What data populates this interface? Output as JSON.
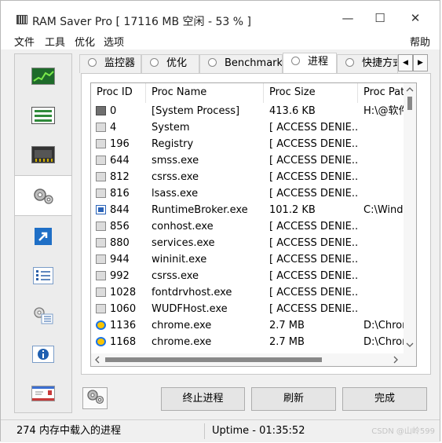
{
  "window": {
    "title": "RAM Saver Pro [ 17116 MB 空闲 - 53 % ]",
    "minimize_glyph": "—",
    "maximize_glyph": "☐",
    "close_glyph": "✕"
  },
  "menu": {
    "file": "文件",
    "tools": "工具",
    "optimize": "优化",
    "options": "选项",
    "help": "帮助"
  },
  "sidebar": {
    "items": [
      {
        "icon": "monitor-chart-icon"
      },
      {
        "icon": "list-icon"
      },
      {
        "icon": "memory-chip-icon"
      },
      {
        "icon": "gears-icon"
      },
      {
        "icon": "shortcut-arrow-icon"
      },
      {
        "icon": "checklist-icon"
      },
      {
        "icon": "settings-list-icon"
      },
      {
        "icon": "info-icon"
      },
      {
        "icon": "mail-icon"
      }
    ],
    "active_index": 3
  },
  "tabs": [
    {
      "label": "监控器"
    },
    {
      "label": "优化"
    },
    {
      "label": "Benchmark"
    },
    {
      "label": "进程"
    },
    {
      "label": "快捷方式"
    }
  ],
  "process_table": {
    "columns": [
      "Proc ID",
      "Proc Name",
      "Proc Size",
      "Proc Pat"
    ],
    "rows": [
      {
        "icon": "system-process-icon",
        "id": "0",
        "name": "[System Process]",
        "size": "413.6 KB",
        "path": "H:\\@软件"
      },
      {
        "icon": "generic-process-icon",
        "id": "4",
        "name": "System",
        "size": "[ ACCESS DENIE...",
        "path": ""
      },
      {
        "icon": "generic-process-icon",
        "id": "196",
        "name": "Registry",
        "size": "[ ACCESS DENIE...",
        "path": ""
      },
      {
        "icon": "generic-process-icon",
        "id": "644",
        "name": "smss.exe",
        "size": "[ ACCESS DENIE...",
        "path": ""
      },
      {
        "icon": "generic-process-icon",
        "id": "812",
        "name": "csrss.exe",
        "size": "[ ACCESS DENIE...",
        "path": ""
      },
      {
        "icon": "generic-process-icon",
        "id": "816",
        "name": "lsass.exe",
        "size": "[ ACCESS DENIE...",
        "path": ""
      },
      {
        "icon": "app-window-icon",
        "id": "844",
        "name": "RuntimeBroker.exe",
        "size": "101.2 KB",
        "path": "C:\\Windo"
      },
      {
        "icon": "generic-process-icon",
        "id": "856",
        "name": "conhost.exe",
        "size": "[ ACCESS DENIE...",
        "path": ""
      },
      {
        "icon": "generic-process-icon",
        "id": "880",
        "name": "services.exe",
        "size": "[ ACCESS DENIE...",
        "path": ""
      },
      {
        "icon": "generic-process-icon",
        "id": "944",
        "name": "wininit.exe",
        "size": "[ ACCESS DENIE...",
        "path": ""
      },
      {
        "icon": "generic-process-icon",
        "id": "992",
        "name": "csrss.exe",
        "size": "[ ACCESS DENIE...",
        "path": ""
      },
      {
        "icon": "generic-process-icon",
        "id": "1028",
        "name": "fontdrvhost.exe",
        "size": "[ ACCESS DENIE...",
        "path": ""
      },
      {
        "icon": "generic-process-icon",
        "id": "1060",
        "name": "WUDFHost.exe",
        "size": "[ ACCESS DENIE...",
        "path": ""
      },
      {
        "icon": "chrome-icon",
        "id": "1136",
        "name": "chrome.exe",
        "size": "2.7 MB",
        "path": "D:\\Chron"
      },
      {
        "icon": "chrome-icon",
        "id": "1168",
        "name": "chrome.exe",
        "size": "2.7 MB",
        "path": "D:\\Chron"
      }
    ]
  },
  "buttons": {
    "kill": "终止进程",
    "refresh": "刷新",
    "done": "完成"
  },
  "status": {
    "process_count": "274 内存中载入的进程",
    "uptime": "Uptime - 01:35:52"
  },
  "watermark": "CSDN @山岭599"
}
